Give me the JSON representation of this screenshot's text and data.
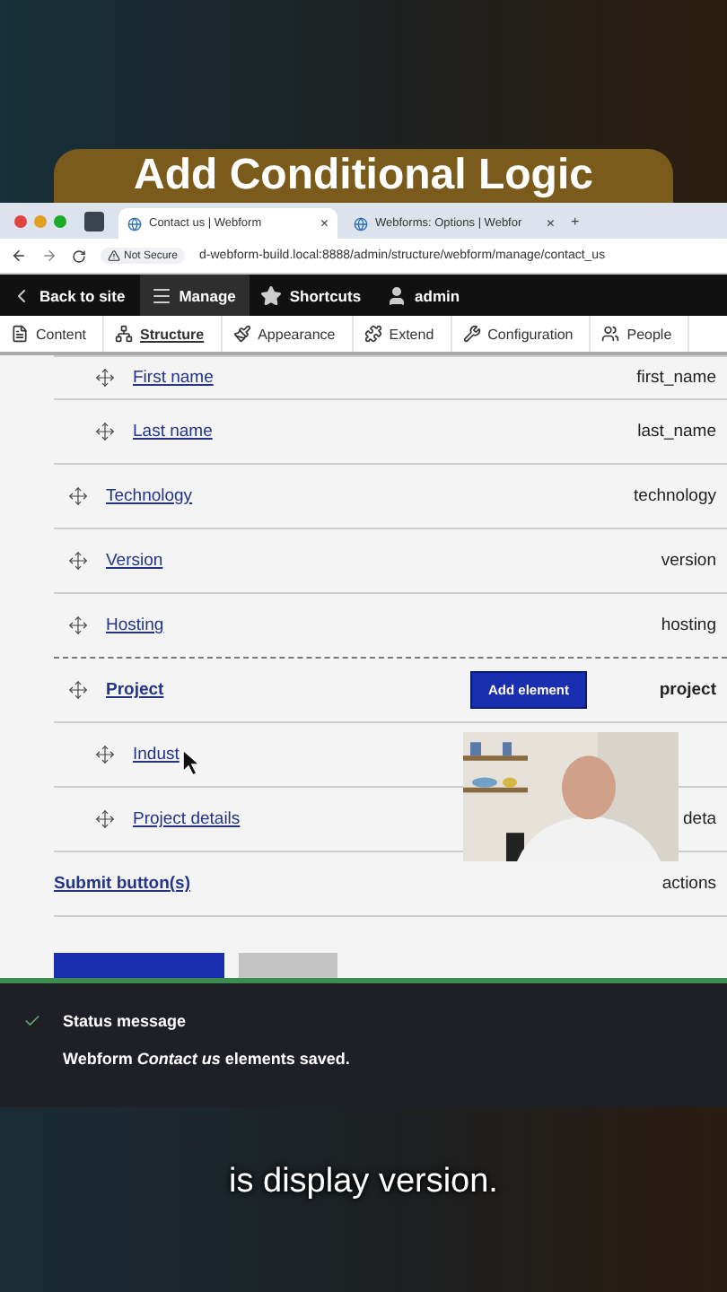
{
  "video_title": "Add Conditional Logic",
  "browser": {
    "tabs": [
      {
        "title": "Contact us | Webform",
        "close": "×",
        "selected": true
      },
      {
        "title": "Webforms: Options | Webfor",
        "close": "×",
        "selected": false
      }
    ],
    "new_tab": "+",
    "security": "Not Secure",
    "url": "d-webform-build.local:8888/admin/structure/webform/manage/contact_us"
  },
  "toolbar": [
    {
      "kind": "back",
      "label": "Back to site",
      "selected": false
    },
    {
      "kind": "menu",
      "label": "Manage",
      "selected": true
    },
    {
      "kind": "star",
      "label": "Shortcuts",
      "selected": false
    },
    {
      "kind": "user",
      "label": "admin",
      "selected": false
    }
  ],
  "admin_menu": [
    {
      "kind": "content",
      "label": "Content",
      "selected": false
    },
    {
      "kind": "structure",
      "label": "Structure",
      "selected": true
    },
    {
      "kind": "appearance",
      "label": "Appearance",
      "selected": false
    },
    {
      "kind": "extend",
      "label": "Extend",
      "selected": false
    },
    {
      "kind": "configuration",
      "label": "Configuration",
      "selected": false
    },
    {
      "kind": "people",
      "label": "People",
      "selected": false
    }
  ],
  "elements": [
    {
      "kind": "continued",
      "children": [
        {
          "kind": "element",
          "title": "First name",
          "key": "first_name"
        },
        {
          "kind": "element",
          "title": "Last name",
          "key": "last_name"
        }
      ]
    },
    {
      "kind": "element",
      "title": "Technology",
      "key": "technology"
    },
    {
      "kind": "element",
      "title": "Version",
      "key": "version"
    },
    {
      "kind": "element",
      "title": "Hosting",
      "key": "hosting"
    },
    {
      "kind": "container",
      "title": "Project",
      "action": "Add element",
      "key": "project",
      "children": [
        {
          "kind": "element",
          "title": "Indust"
        },
        {
          "kind": "element",
          "title": "Project details",
          "key": "deta"
        }
      ]
    },
    {
      "kind": "actions",
      "title": "Submit button(s)",
      "key": "actions"
    }
  ],
  "status": {
    "title": "Status message",
    "message": "Webform *Contact us* elements saved."
  },
  "caption": "is display version."
}
